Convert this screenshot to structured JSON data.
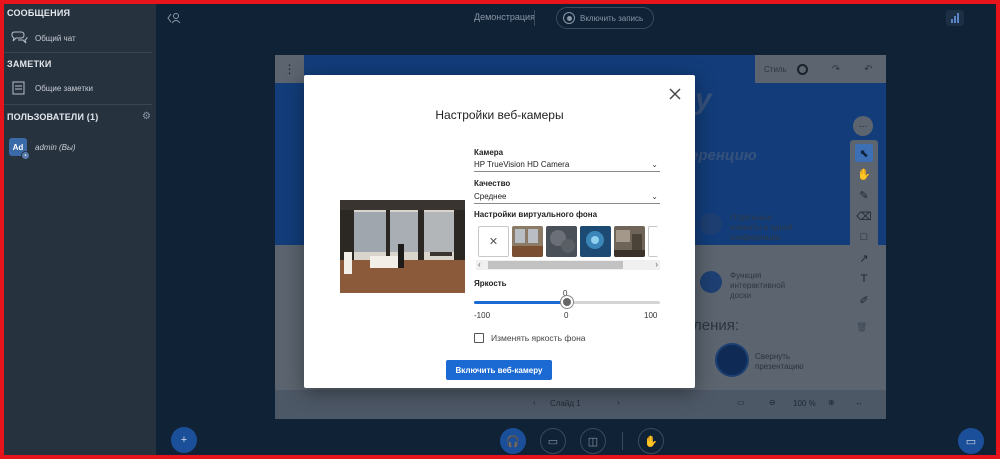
{
  "sidebar": {
    "messages_header": "СООБЩЕНИЯ",
    "public_chat": "Общий чат",
    "notes_header": "ЗАМЕТКИ",
    "shared_notes": "Общие заметки",
    "users_header": "ПОЛЬЗОВАТЕЛИ (1)",
    "user_initials": "Ad",
    "user_name": "admin (Вы)"
  },
  "topbar": {
    "presentation_title": "Демонстрация",
    "record_label": "Включить запись"
  },
  "slide": {
    "style_label": "Стиль",
    "bg_title_fragment": "у",
    "bg_subtitle_fragment": "еренцию",
    "feature1": "Отдельные комнаты в одной конференции",
    "feature2": "Функция интерактивной доски",
    "heading_fragment": "ления:",
    "collapse_label": "Свернуть презентацию",
    "slide_selector": "Слайд 1",
    "zoom": "100 %"
  },
  "modal": {
    "title": "Настройки веб-камеры",
    "camera_label": "Камера",
    "camera_value": "HP TrueVision HD Camera",
    "quality_label": "Качество",
    "quality_value": "Среднее",
    "vbg_label": "Настройки виртуального фона",
    "brightness_label": "Яркость",
    "brightness_value": "0",
    "brightness_min": "-100",
    "brightness_mid": "0",
    "brightness_max": "100",
    "brightness_level": 0.5,
    "change_bg_brightness": "Изменять яркость фона",
    "enable_button": "Включить веб-камеру"
  },
  "colors": {
    "accent": "#1b6ad3",
    "frame": "#e8141b",
    "sidebar_bg": "#27323f",
    "main_bg": "#0f2236"
  },
  "icons": [
    "chat-icon",
    "notes-icon",
    "gear-icon",
    "collapse-icon",
    "record-icon",
    "stats-icon",
    "menu-dots-icon",
    "undo-icon",
    "redo-icon",
    "close-icon",
    "none-icon",
    "select-tool-icon",
    "hand-tool-icon",
    "pencil-icon",
    "eraser-icon",
    "rectangle-icon",
    "arrow-icon",
    "text-icon",
    "sticky-icon",
    "trash-icon",
    "plus-icon",
    "mic-icon",
    "camera-off-icon",
    "screen-share-icon",
    "raise-hand-icon",
    "presentation-icon"
  ]
}
